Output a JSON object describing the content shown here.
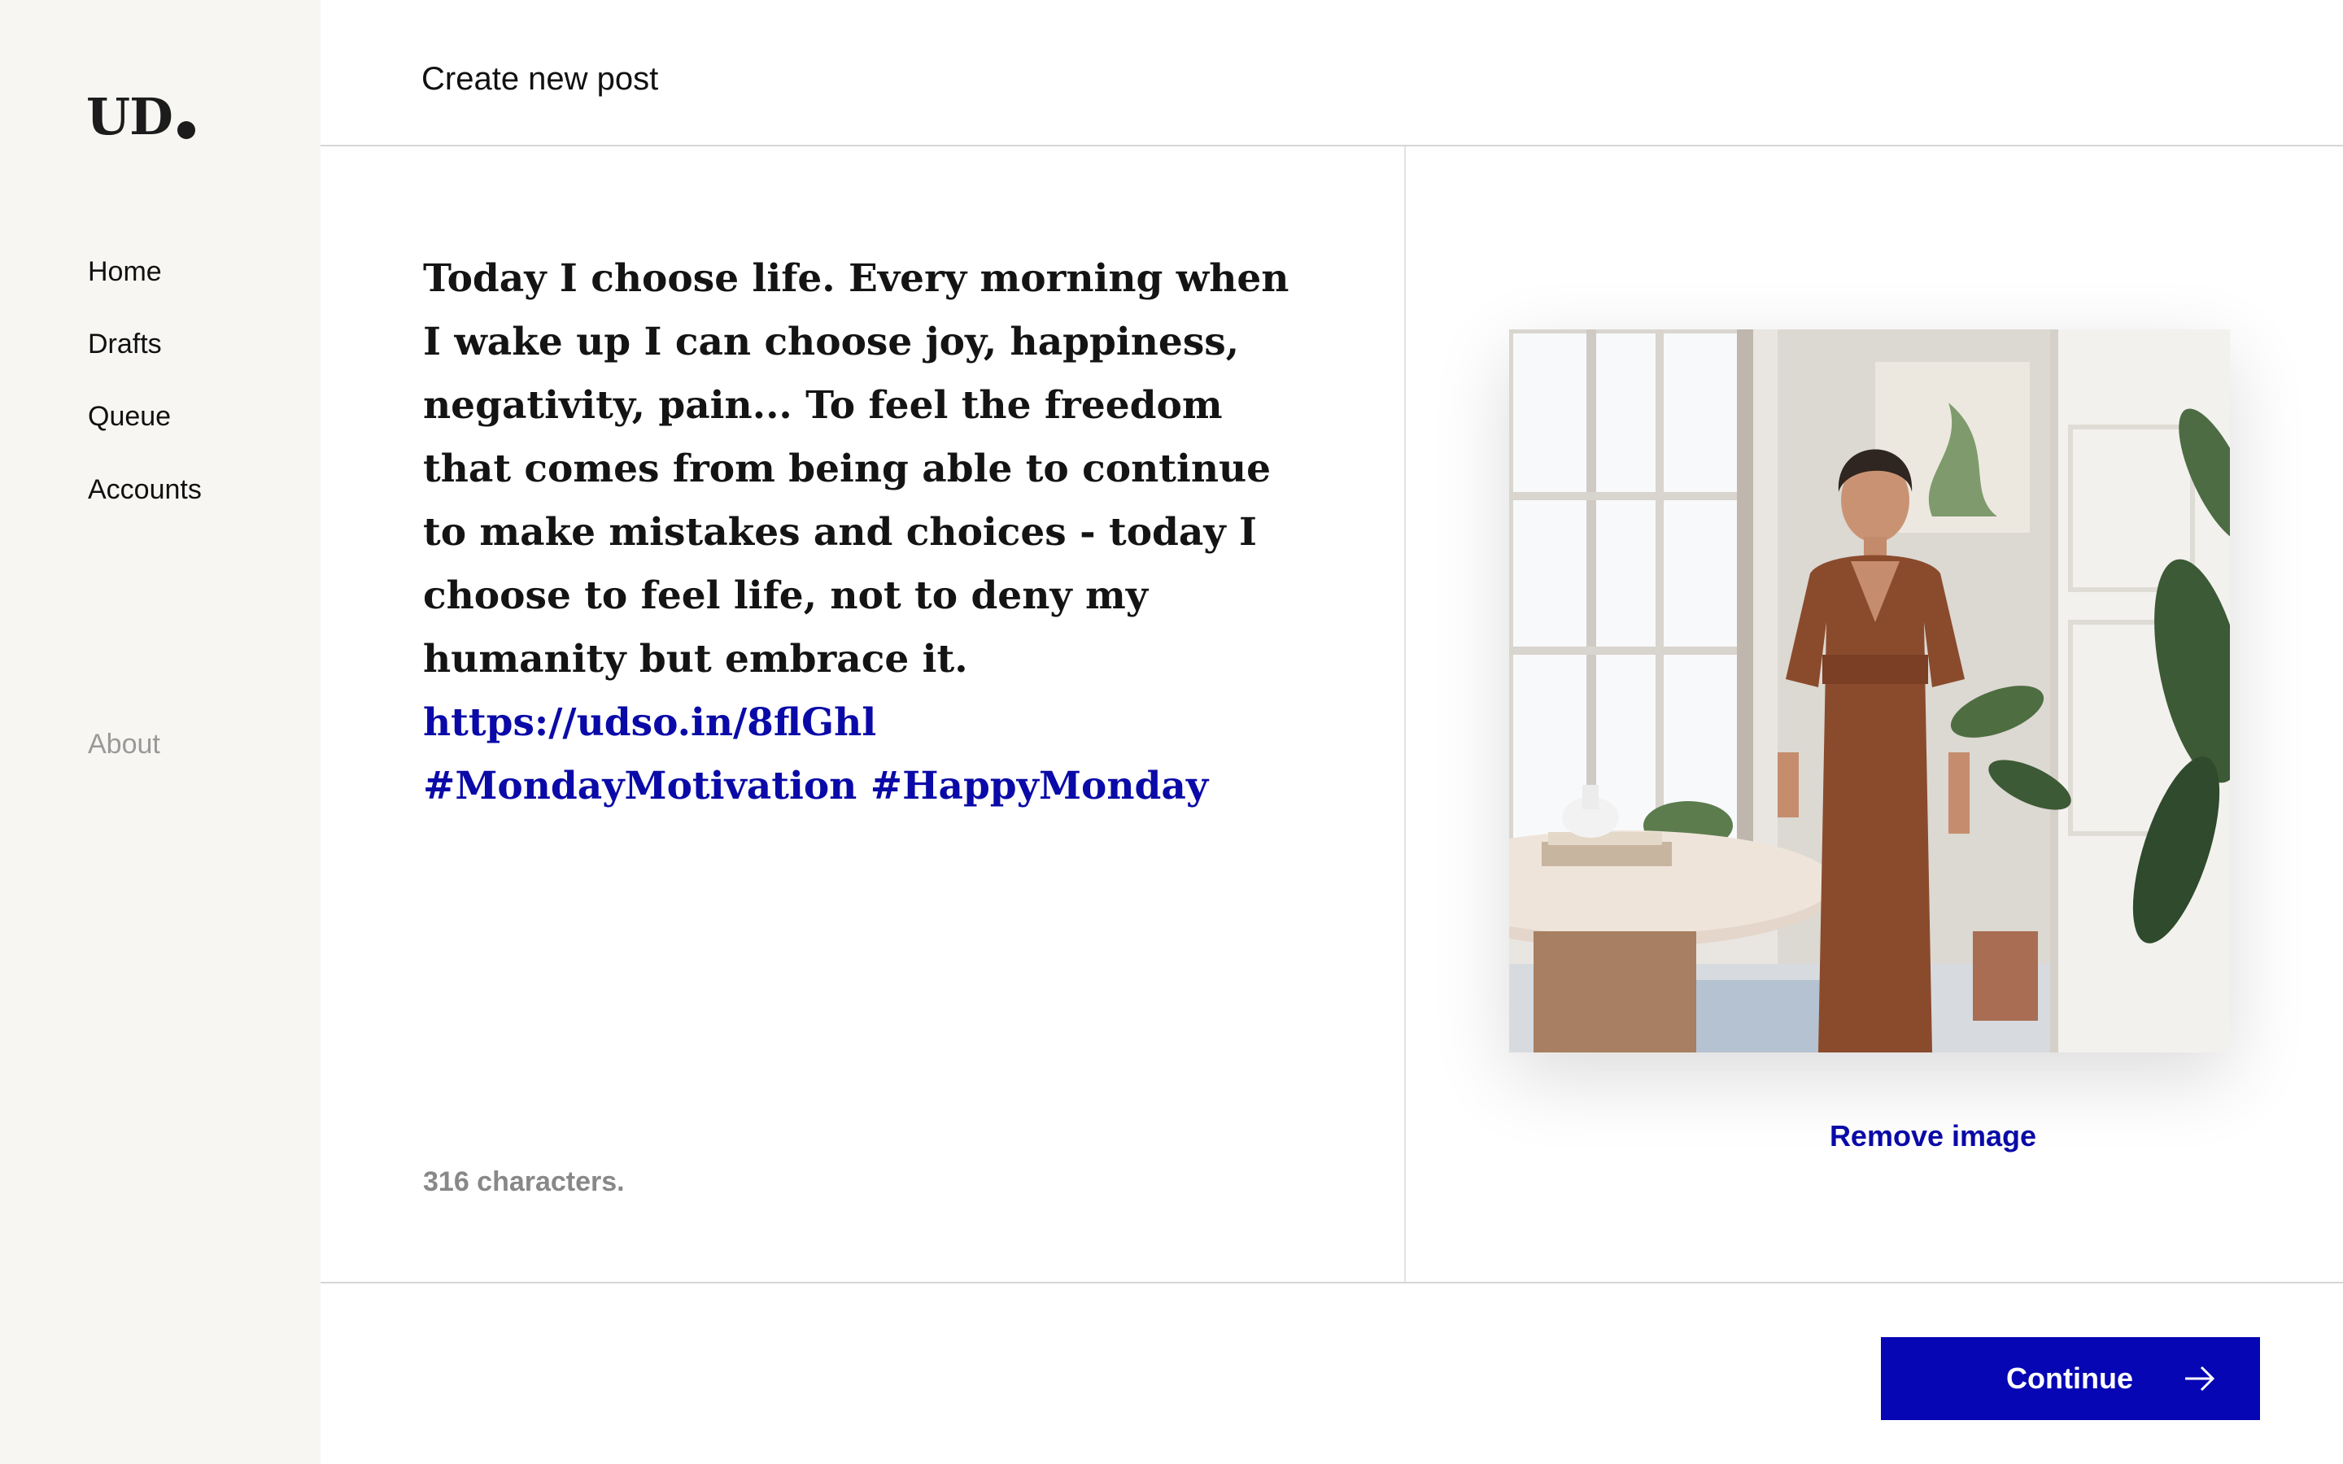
{
  "sidebar": {
    "logo": "UD",
    "nav": [
      {
        "label": "Home"
      },
      {
        "label": "Drafts"
      },
      {
        "label": "Queue"
      },
      {
        "label": "Accounts"
      }
    ],
    "about_label": "About"
  },
  "header": {
    "title": "Create new post"
  },
  "editor": {
    "body": "Today I choose life. Every morning when I wake up I can choose joy, happiness, negativity, pain... To feel the freedom that comes from being able to continue to make mistakes and choices - today I choose to feel life, not to deny my humanity but embrace it.",
    "link": "https://udso.in/8flGhl",
    "hashtags": "#MondayMotivation #HappyMonday",
    "char_count": "316 characters."
  },
  "image_panel": {
    "remove_label": "Remove image"
  },
  "footer": {
    "continue_label": "Continue",
    "continue_icon": "arrow-right-icon"
  },
  "colors": {
    "accent": "#0606b4",
    "link": "#0a0aa8",
    "sidebar_bg": "#f7f6f3"
  }
}
